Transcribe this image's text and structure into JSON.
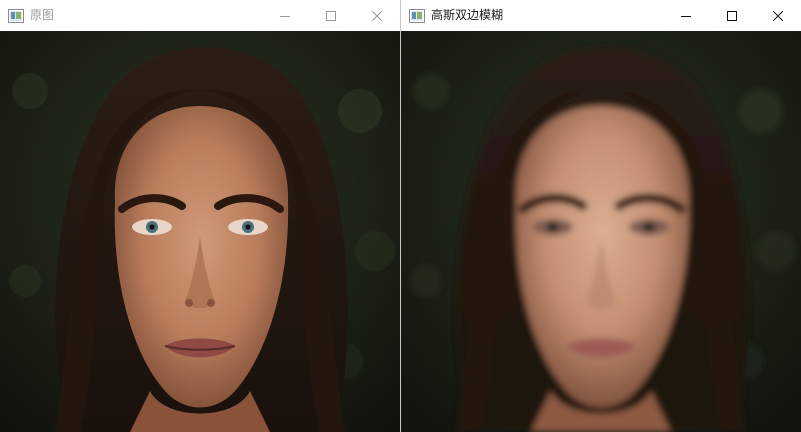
{
  "windows": {
    "left": {
      "title": "原图",
      "state": "inactive",
      "image": "portrait-original"
    },
    "right": {
      "title": "高斯双边模糊",
      "state": "active",
      "image": "portrait-gaussian-bilateral-blur"
    }
  },
  "icons": {
    "app": "app-window-icon",
    "minimize": "minimize-icon",
    "maximize": "maximize-icon",
    "close": "close-icon"
  },
  "colors": {
    "titlebar": "#ffffff",
    "inactive_title_text": "#9a9a9a",
    "active_title_text": "#1a1a1a",
    "background_foliage": "#1a1f16",
    "skin": "#c48a6a",
    "hair": "#2a1a12"
  }
}
